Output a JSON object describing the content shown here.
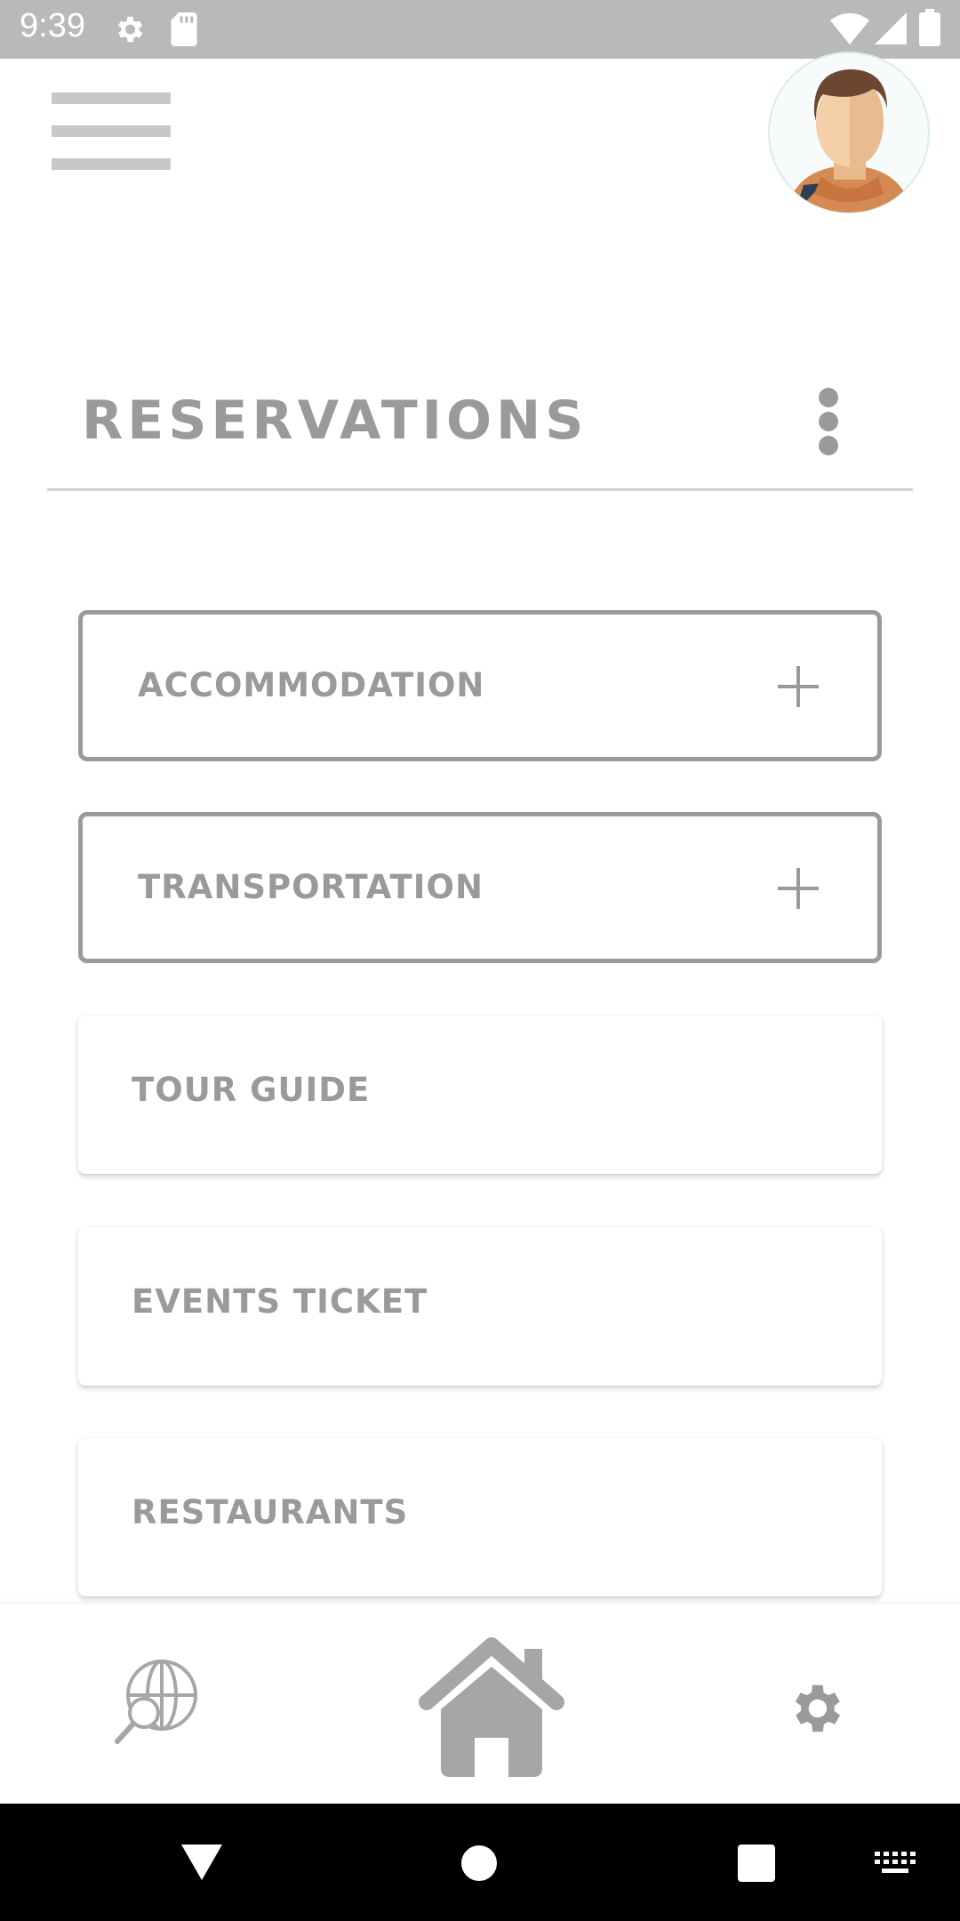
{
  "status_bar": {
    "time": "9:39"
  },
  "header": {
    "title": "RESERVATIONS"
  },
  "reservations": {
    "items": [
      {
        "label": "ACCOMMODATION"
      },
      {
        "label": "TRANSPORTATION"
      },
      {
        "label": "TOUR GUIDE"
      },
      {
        "label": "EVENTS TICKET"
      },
      {
        "label": "RESTAURANTS"
      }
    ]
  },
  "icons": {
    "menu": "hamburger-icon",
    "more": "kebab-icon",
    "expand": "plus-icon",
    "explore": "globe-search-icon",
    "home": "home-icon",
    "settings": "gear-icon"
  },
  "colors": {
    "status_bar": "#b9b9b9",
    "text_muted": "#9a9a9a",
    "border": "#9a9a9a",
    "system_nav": "#000000"
  }
}
